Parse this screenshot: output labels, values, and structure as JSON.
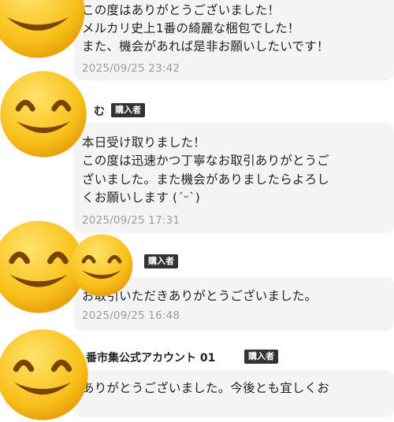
{
  "reviews": [
    {
      "lines": [
        "この度はありがとうございました！",
        "メルカリ史上1番の綺麗な梱包でした！",
        "また、機会があれば是非お願いしたいです！"
      ],
      "date": "2025/09/25 23:42"
    },
    {
      "name": "む",
      "badge": "購入者",
      "lines": [
        "本日受け取りました！",
        "この度は迅速かつ丁寧なお取引ありがとうご",
        "ざいました。また機会がありましたらよろし",
        "くお願いします (ˊᵕˋ)"
      ],
      "date": "2025/09/25 17:31"
    },
    {
      "name": "",
      "badge": "購入者",
      "lines": [
        "お取引いただきありがとうございました。"
      ],
      "date": "2025/09/25 16:48"
    },
    {
      "name": "番市集公式アカウント 01",
      "badge": "購入者",
      "lines": [
        "ありがとうございました。今後とも宜しくお"
      ]
    }
  ],
  "colors": {
    "bubble": "#f4f4f4",
    "badge": "#333333",
    "timestamp": "#9a9a9a",
    "emoji_face": "#f8c019"
  },
  "icons": [
    "smiling-face-emoji"
  ]
}
